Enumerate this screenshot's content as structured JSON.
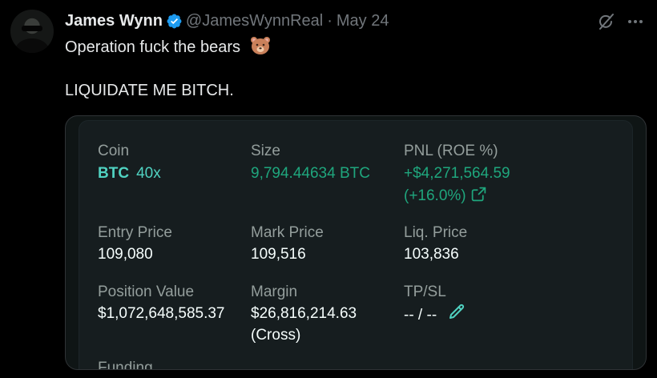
{
  "tweet": {
    "author_name": "James Wynn",
    "handle": "@JamesWynnReal",
    "separator": "·",
    "date": "May 24",
    "line1": "Operation fuck the bears",
    "line2": "LIQUIDATE ME BITCH."
  },
  "position": {
    "coin_label": "Coin",
    "coin": "BTC",
    "leverage": "40x",
    "size_label": "Size",
    "size": "9,794.44634 BTC",
    "pnl_label": "PNL (ROE %)",
    "pnl": "+$4,271,564.59",
    "roe": "(+16.0%)",
    "entry_label": "Entry Price",
    "entry": "109,080",
    "mark_label": "Mark Price",
    "mark": "109,516",
    "liq_label": "Liq. Price",
    "liq": "103,836",
    "value_label": "Position Value",
    "value": "$1,072,648,585.37",
    "margin_label": "Margin",
    "margin": "$26,816,214.63",
    "margin_mode": "(Cross)",
    "tpsl_label": "TP/SL",
    "tpsl": "-- / --",
    "funding_label": "Funding"
  },
  "colors": {
    "accent": "#50d2c1",
    "positive": "#1fa67d",
    "verified": "#1d9bf0"
  },
  "icons": [
    "verified-badge-icon",
    "grok-icon",
    "more-icon",
    "bear-emoji-icon",
    "external-link-icon",
    "pencil-icon"
  ]
}
